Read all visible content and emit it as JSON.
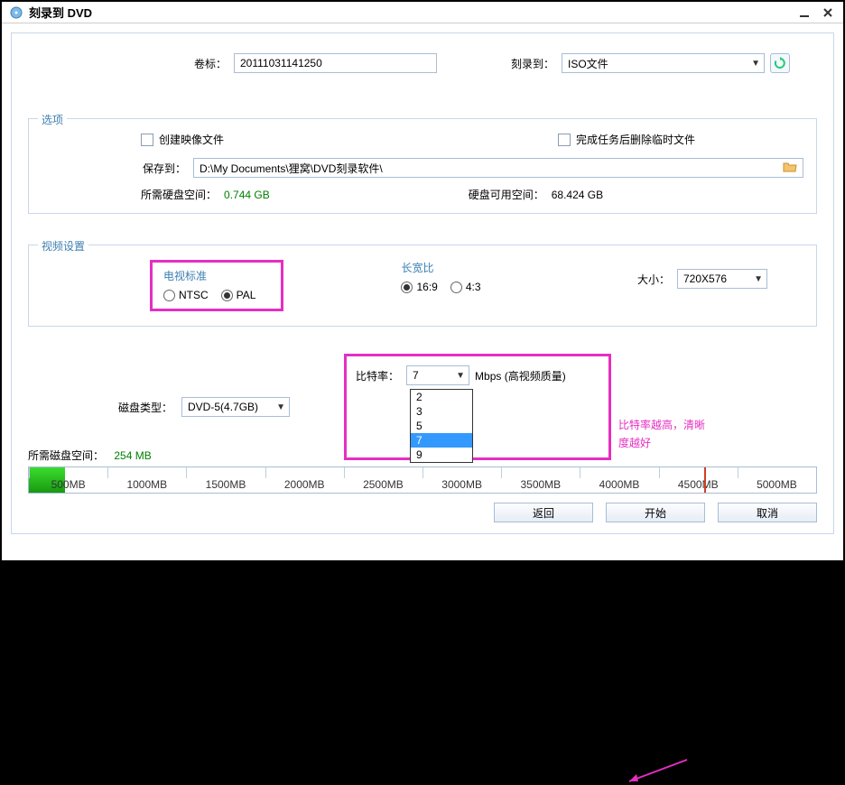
{
  "window": {
    "title": "刻录到 DVD"
  },
  "row1": {
    "volume_label": "卷标：",
    "volume_value": "20111031141250",
    "burn_label": "刻录到：",
    "burn_value": "ISO文件"
  },
  "options": {
    "legend": "选项",
    "create_image": "创建映像文件",
    "delete_temp": "完成任务后删除临时文件",
    "save_to_label": "保存到：",
    "save_to_path": "D:\\My Documents\\狸窝\\DVD刻录软件\\",
    "need_space_label": "所需硬盘空间：",
    "need_space_value": "0.744 GB",
    "avail_space_label": "硬盘可用空间：",
    "avail_space_value": "68.424 GB"
  },
  "video": {
    "legend": "视频设置",
    "tv_title": "电视标准",
    "tv_ntsc": "NTSC",
    "tv_pal": "PAL",
    "aspect_title": "长宽比",
    "aspect_169": "16:9",
    "aspect_43": "4:3",
    "size_label": "大小：",
    "size_value": "720X576"
  },
  "disk": {
    "type_label": "磁盘类型：",
    "type_value": "DVD-5(4.7GB)",
    "bitrate_label": "比特率：",
    "bitrate_value": "7",
    "bitrate_options": [
      "2",
      "3",
      "5",
      "7",
      "9"
    ],
    "bitrate_suffix": "Mbps (高视频质量)"
  },
  "annotation": {
    "line1": "比特率越高，清晰",
    "line2": "度越好"
  },
  "storage": {
    "label": "所需磁盘空间：",
    "value": "254 MB",
    "ticks": [
      "500MB",
      "1000MB",
      "1500MB",
      "2000MB",
      "2500MB",
      "3000MB",
      "3500MB",
      "4000MB",
      "4500MB",
      "5000MB"
    ]
  },
  "buttons": {
    "back": "返回",
    "start": "开始",
    "cancel": "取消"
  }
}
